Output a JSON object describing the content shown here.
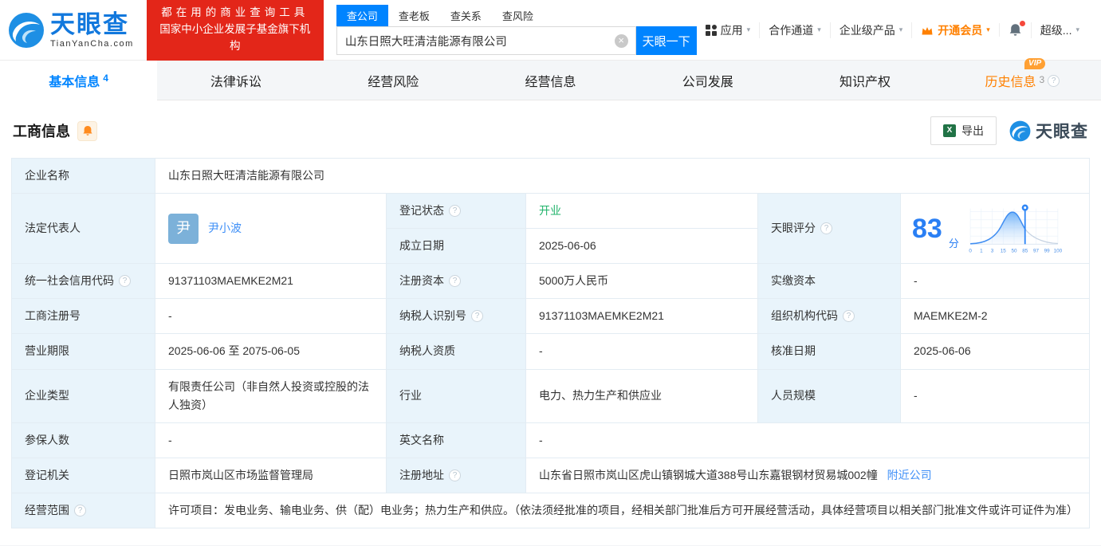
{
  "colors": {
    "brand_blue": "#0084ff",
    "logo_blue": "#1278dd",
    "promo_red": "#e32619",
    "vip_orange": "#ff8000",
    "status_green": "#21b36b",
    "link_blue": "#3e8ff7",
    "label_cell_bg": "#e9f4fb",
    "score_blue": "#2a7ff4"
  },
  "icons": {
    "help": "?",
    "caret": "▾",
    "clear": "×",
    "excel": "X"
  },
  "header": {
    "logo_title": "天眼查",
    "logo_subtitle": "TianYanCha.com",
    "promo_line1": "都在用的商业查询工具",
    "promo_line2": "国家中小企业发展子基金旗下机构",
    "search_tabs": [
      {
        "label": "查公司"
      },
      {
        "label": "查老板"
      },
      {
        "label": "查关系"
      },
      {
        "label": "查风险"
      }
    ],
    "search_value": "山东日照大旺清洁能源有限公司",
    "search_button": "天眼一下",
    "nav": {
      "apps": "应用",
      "partner": "合作通道",
      "enterprise": "企业级产品",
      "vip": "开通会员",
      "super": "超级..."
    }
  },
  "tabs": [
    {
      "label": "基本信息",
      "count": "4"
    },
    {
      "label": "法律诉讼"
    },
    {
      "label": "经营风险"
    },
    {
      "label": "经营信息"
    },
    {
      "label": "公司发展"
    },
    {
      "label": "知识产权"
    },
    {
      "label": "历史信息",
      "count": "3",
      "badge": "VIP"
    }
  ],
  "section": {
    "title": "工商信息",
    "export_label": "导出",
    "watermark": "天眼查"
  },
  "fields": {
    "company_name": {
      "label": "企业名称",
      "value": "山东日照大旺清洁能源有限公司"
    },
    "legal_rep": {
      "label": "法定代表人",
      "avatar": "尹",
      "value": "尹小波"
    },
    "reg_status": {
      "label": "登记状态",
      "value": "开业"
    },
    "establish_date": {
      "label": "成立日期",
      "value": "2025-06-06"
    },
    "score": {
      "label": "天眼评分",
      "value": "83",
      "unit": "分",
      "axis": [
        "0",
        "1",
        "3",
        "15",
        "50",
        "85",
        "97",
        "99",
        "100"
      ]
    },
    "credit_code": {
      "label": "统一社会信用代码",
      "value": "91371103MAEMKE2M21"
    },
    "reg_capital": {
      "label": "注册资本",
      "value": "5000万人民币"
    },
    "paid_capital": {
      "label": "实缴资本",
      "value": "-"
    },
    "reg_number": {
      "label": "工商注册号",
      "value": "-"
    },
    "taxpayer_id": {
      "label": "纳税人识别号",
      "value": "91371103MAEMKE2M21"
    },
    "org_code": {
      "label": "组织机构代码",
      "value": "MAEMKE2M-2"
    },
    "business_term": {
      "label": "营业期限",
      "value": "2025-06-06 至 2075-06-05"
    },
    "taxpayer_quality": {
      "label": "纳税人资质",
      "value": "-"
    },
    "approval_date": {
      "label": "核准日期",
      "value": "2025-06-06"
    },
    "company_type": {
      "label": "企业类型",
      "value": "有限责任公司（非自然人投资或控股的法人独资）"
    },
    "industry": {
      "label": "行业",
      "value": "电力、热力生产和供应业"
    },
    "staff_size": {
      "label": "人员规模",
      "value": "-"
    },
    "insured_count": {
      "label": "参保人数",
      "value": "-"
    },
    "english_name": {
      "label": "英文名称",
      "value": "-"
    },
    "reg_authority": {
      "label": "登记机关",
      "value": "日照市岚山区市场监督管理局"
    },
    "reg_address": {
      "label": "注册地址",
      "value": "山东省日照市岚山区虎山镇钢城大道388号山东嘉银钢材贸易城002幢",
      "link": "附近公司"
    },
    "business_scope": {
      "label": "经营范围",
      "value": "许可项目：发电业务、输电业务、供（配）电业务；热力生产和供应。（依法须经批准的项目，经相关部门批准后方可开展经营活动，具体经营项目以相关部门批准文件或许可证件为准）"
    }
  }
}
